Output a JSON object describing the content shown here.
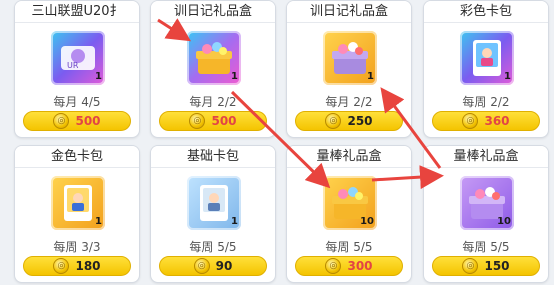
{
  "shop": {
    "cards": [
      {
        "title": "三山联盟U20扌",
        "limit": "每月 4/5",
        "price": "500",
        "price_color": "#e24545",
        "qty": "1",
        "icon": "ticket-icon"
      },
      {
        "title": "训日记礼品盒",
        "limit": "每月 2/2",
        "price": "500",
        "price_color": "#e24545",
        "qty": "1",
        "icon": "giftbox-icon"
      },
      {
        "title": "训日记礼品盒",
        "limit": "每月 2/2",
        "price": "250",
        "price_color": "#222222",
        "qty": "1",
        "icon": "giftbox-icon"
      },
      {
        "title": "彩色卡包",
        "limit": "每周 2/2",
        "price": "360",
        "price_color": "#e24545",
        "qty": "1",
        "icon": "card-pack-icon"
      },
      {
        "title": "金色卡包",
        "limit": "每周 3/3",
        "price": "180",
        "price_color": "#222222",
        "qty": "1",
        "icon": "card-pack-icon"
      },
      {
        "title": "基础卡包",
        "limit": "每周 5/5",
        "price": "90",
        "price_color": "#222222",
        "qty": "1",
        "icon": "card-pack-icon"
      },
      {
        "title": "量棒礼品盒",
        "limit": "每周 5/5",
        "price": "300",
        "price_color": "#e24545",
        "qty": "10",
        "icon": "giftbox-icon"
      },
      {
        "title": "量棒礼品盒",
        "limit": "每周 5/5",
        "price": "150",
        "price_color": "#222222",
        "qty": "10",
        "icon": "giftbox-icon"
      }
    ]
  },
  "colors": {
    "accent": "#f4c400",
    "arrow": "#e8443e"
  }
}
